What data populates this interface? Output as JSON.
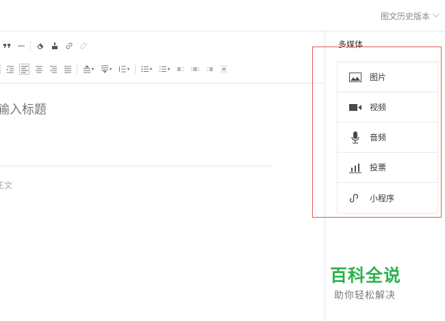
{
  "header": {
    "history_label": "图文历史版本"
  },
  "editor": {
    "title_placeholder": "输入标题",
    "body_placeholder": "正文"
  },
  "sidebar": {
    "section_title": "多媒体",
    "items": [
      {
        "label": "图片",
        "icon": "image-icon"
      },
      {
        "label": "视频",
        "icon": "video-icon"
      },
      {
        "label": "音频",
        "icon": "microphone-icon"
      },
      {
        "label": "投票",
        "icon": "bar-chart-icon"
      },
      {
        "label": "小程序",
        "icon": "mini-program-icon"
      }
    ]
  },
  "highlight_color": "#e0574f",
  "watermark": {
    "title": "百科全说",
    "subtitle": "助你轻松解决",
    "color": "#2bb24c"
  }
}
